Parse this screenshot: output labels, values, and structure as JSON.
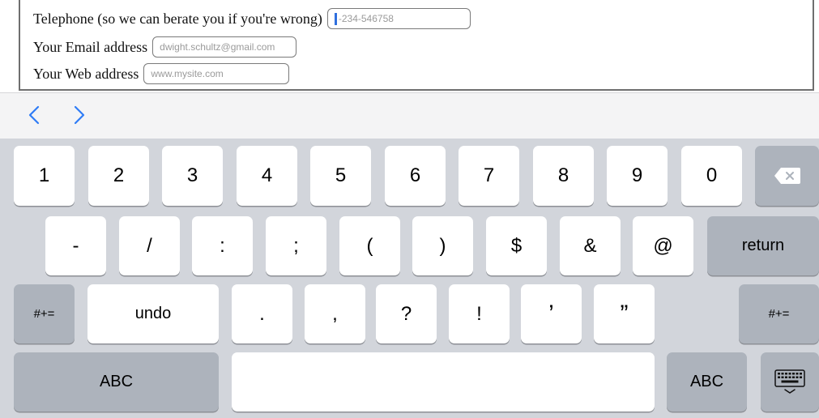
{
  "form": {
    "fields": [
      {
        "label": "Telephone (so we can berate you if you're wrong)",
        "placeholder": "-234-546758"
      },
      {
        "label": "Your Email address",
        "placeholder": "dwight.schultz@gmail.com"
      },
      {
        "label": "Your Web address",
        "placeholder": "www.mysite.com"
      }
    ]
  },
  "accessory_bar": {
    "prev_icon": "chevron-left-icon",
    "next_icon": "chevron-right-icon",
    "accent_color": "#2f7cf6"
  },
  "keyboard": {
    "row1": [
      "1",
      "2",
      "3",
      "4",
      "5",
      "6",
      "7",
      "8",
      "9",
      "0"
    ],
    "backspace_icon": "backspace-icon",
    "row2": [
      "-",
      "/",
      ":",
      ";",
      "(",
      ")",
      "$",
      "&",
      "@"
    ],
    "return_label": "return",
    "shift_label": "#+=",
    "undo_label": "undo",
    "row3": [
      ".",
      ",",
      "?",
      "!",
      "’",
      "”"
    ],
    "abc_label": "ABC",
    "dismiss_icon": "keyboard-dismiss-icon",
    "colors": {
      "key_background": "#ffffff",
      "function_key_background": "#adb3bc",
      "keyboard_background": "#d2d5db"
    }
  }
}
